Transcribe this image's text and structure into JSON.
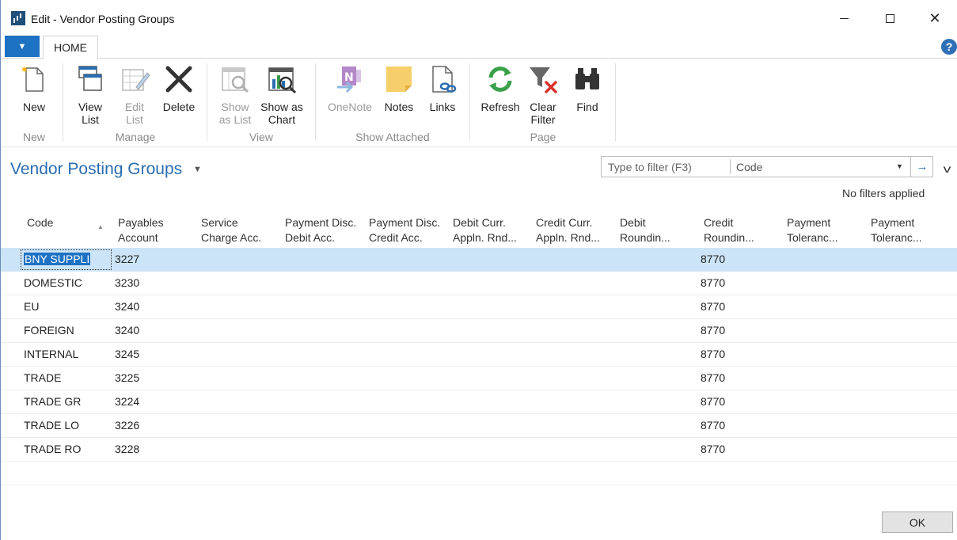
{
  "window": {
    "title": "Edit - Vendor Posting Groups",
    "close_glyph": "✕"
  },
  "ribbon": {
    "file_glyph": "▼",
    "tab": "HOME",
    "help_glyph": "?",
    "groups": {
      "new": "New",
      "manage": "Manage",
      "view": "View",
      "show_attached": "Show Attached",
      "page": "Page"
    },
    "buttons": {
      "new": "New",
      "view_list_1": "View",
      "view_list_2": "List",
      "edit_list_1": "Edit",
      "edit_list_2": "List",
      "delete": "Delete",
      "show_as_list_1": "Show",
      "show_as_list_2": "as List",
      "show_as_chart_1": "Show as",
      "show_as_chart_2": "Chart",
      "onenote": "OneNote",
      "notes": "Notes",
      "links": "Links",
      "refresh": "Refresh",
      "clear_filter_1": "Clear",
      "clear_filter_2": "Filter",
      "find": "Find"
    }
  },
  "page": {
    "title": "Vendor Posting Groups",
    "title_chevron": "▼",
    "filter_placeholder": "Type to filter (F3)",
    "filter_field": "Code",
    "filter_dropdown": "▼",
    "filter_go": "→",
    "collapse": "v",
    "no_filters": "No filters applied"
  },
  "grid": {
    "columns": [
      {
        "l1": "Code",
        "l2": ""
      },
      {
        "l1": "Payables",
        "l2": "Account"
      },
      {
        "l1": "Service",
        "l2": "Charge Acc."
      },
      {
        "l1": "Payment Disc.",
        "l2": "Debit Acc."
      },
      {
        "l1": "Payment Disc.",
        "l2": "Credit Acc."
      },
      {
        "l1": "Debit Curr.",
        "l2": "Appln. Rnd..."
      },
      {
        "l1": "Credit Curr.",
        "l2": "Appln. Rnd..."
      },
      {
        "l1": "Debit",
        "l2": "Roundin..."
      },
      {
        "l1": "Credit",
        "l2": "Roundin..."
      },
      {
        "l1": "Payment",
        "l2": "Toleranc..."
      },
      {
        "l1": "Payment",
        "l2": "Toleranc..."
      }
    ],
    "sort_glyph": "▲",
    "rows": [
      {
        "code": "BNY SUPPLI",
        "payables": "3227",
        "credit_rounding": "8770"
      },
      {
        "code": "DOMESTIC",
        "payables": "3230",
        "credit_rounding": "8770"
      },
      {
        "code": "EU",
        "payables": "3240",
        "credit_rounding": "8770"
      },
      {
        "code": "FOREIGN",
        "payables": "3240",
        "credit_rounding": "8770"
      },
      {
        "code": "INTERNAL",
        "payables": "3245",
        "credit_rounding": "8770"
      },
      {
        "code": "TRADE",
        "payables": "3225",
        "credit_rounding": "8770"
      },
      {
        "code": "TRADE GR",
        "payables": "3224",
        "credit_rounding": "8770"
      },
      {
        "code": "TRADE LO",
        "payables": "3226",
        "credit_rounding": "8770"
      },
      {
        "code": "TRADE RO",
        "payables": "3228",
        "credit_rounding": "8770"
      }
    ]
  },
  "footer": {
    "ok": "OK"
  },
  "icons": {
    "new": "new-document-icon",
    "view_list": "view-list-icon",
    "edit_list": "edit-list-icon",
    "delete": "delete-x-icon",
    "show_as_list": "show-as-list-icon",
    "show_as_chart": "show-as-chart-icon",
    "onenote": "onenote-icon",
    "notes": "notes-icon",
    "links": "links-icon",
    "refresh": "refresh-icon",
    "clear_filter": "clear-filter-icon",
    "find": "binoculars-icon"
  },
  "colors": {
    "accent": "#1e72c4",
    "title_blue": "#2b6cb0",
    "selected_row": "#cce4f7"
  }
}
